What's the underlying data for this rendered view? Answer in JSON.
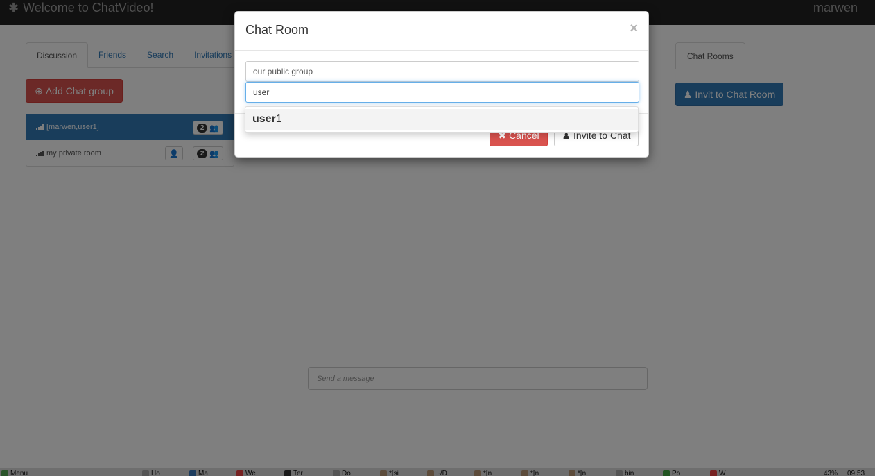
{
  "navbar": {
    "brand": "Welcome to ChatVideo!",
    "user": "marwen"
  },
  "left_tabs": [
    {
      "label": "Discussion",
      "active": true
    },
    {
      "label": "Friends",
      "active": false
    },
    {
      "label": "Search",
      "active": false
    },
    {
      "label": "Invitations",
      "active": false
    }
  ],
  "add_group_label": "Add Chat group",
  "rooms": [
    {
      "name": "[marwen,user1]",
      "count": "2",
      "active": true
    },
    {
      "name": "my private room",
      "count": "2",
      "active": false
    }
  ],
  "right_tab": "Chat Rooms",
  "invit_button": "Invit to Chat Room",
  "message_placeholder": "Send a message",
  "modal": {
    "title": "Chat Room",
    "close": "×",
    "room_value": "our public group",
    "user_value": "user",
    "suggestion_match": "user",
    "suggestion_rest": "1",
    "cancel_label": "Cancel",
    "invite_label": "Invite to Chat"
  },
  "taskbar": [
    "Menu",
    "Ho",
    "Ma",
    "We",
    "Ter",
    "Do",
    "*[si",
    "~/D",
    "*[n",
    "*[n",
    "*[n",
    "bin",
    "Po",
    "W",
    "43%",
    "09:53"
  ],
  "colors": {
    "primary": "#337ab7",
    "danger": "#d9534f",
    "navbar": "#222222"
  }
}
